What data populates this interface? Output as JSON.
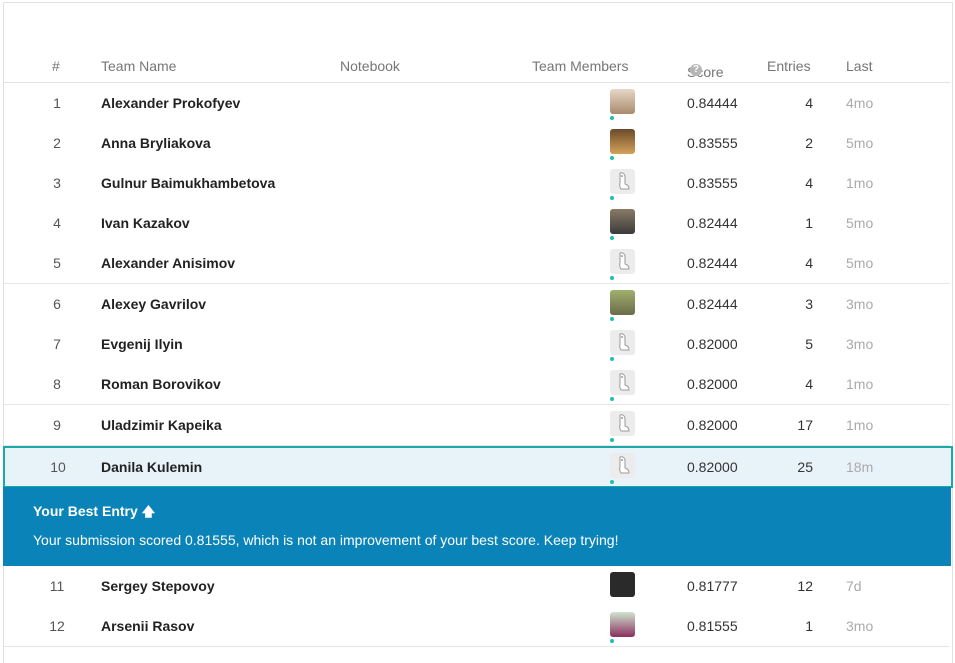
{
  "header": {
    "rank": "#",
    "team_name": "Team Name",
    "notebook": "Notebook",
    "team_members": "Team Members",
    "score": "Score",
    "entries": "Entries",
    "last": "Last"
  },
  "rows": [
    {
      "rank": "1",
      "name": "Alexander Prokofyev",
      "score": "0.84444",
      "entries": "4",
      "last": "4mo",
      "avatar": "photo"
    },
    {
      "rank": "2",
      "name": "Anna Bryliakova",
      "score": "0.83555",
      "entries": "2",
      "last": "5mo",
      "avatar": "photo"
    },
    {
      "rank": "3",
      "name": "Gulnur Baimukhambetova",
      "score": "0.83555",
      "entries": "4",
      "last": "1mo",
      "avatar": "goose"
    },
    {
      "rank": "4",
      "name": "Ivan Kazakov",
      "score": "0.82444",
      "entries": "1",
      "last": "5mo",
      "avatar": "photo"
    },
    {
      "rank": "5",
      "name": "Alexander Anisimov",
      "score": "0.82444",
      "entries": "4",
      "last": "5mo",
      "avatar": "goose"
    },
    {
      "rank": "6",
      "name": "Alexey Gavrilov",
      "score": "0.82444",
      "entries": "3",
      "last": "3mo",
      "avatar": "photo"
    },
    {
      "rank": "7",
      "name": "Evgenij Ilyin",
      "score": "0.82000",
      "entries": "5",
      "last": "3mo",
      "avatar": "goose"
    },
    {
      "rank": "8",
      "name": "Roman Borovikov",
      "score": "0.82000",
      "entries": "4",
      "last": "1mo",
      "avatar": "goose"
    },
    {
      "rank": "9",
      "name": "Uladzimir Kapeika",
      "score": "0.82000",
      "entries": "17",
      "last": "1mo",
      "avatar": "goose"
    },
    {
      "rank": "10",
      "name": "Danila Kulemin",
      "score": "0.82000",
      "entries": "25",
      "last": "18m",
      "avatar": "goose"
    },
    {
      "rank": "11",
      "name": "Sergey Stepovoy",
      "score": "0.81777",
      "entries": "12",
      "last": "7d",
      "avatar": "photo"
    },
    {
      "rank": "12",
      "name": "Arsenii Rasov",
      "score": "0.81555",
      "entries": "1",
      "last": "3mo",
      "avatar": "photo"
    }
  ],
  "banner": {
    "title": "Your Best Entry",
    "message": "Your submission scored 0.81555, which is not an improvement of your best score. Keep trying!"
  },
  "icons": {
    "help": "question-circle-icon",
    "arrow": "arrow-up-icon"
  },
  "colors": {
    "banner_bg": "#0a84b8",
    "highlight_border": "#1ca8a8",
    "highlight_bg": "#e8f3f9",
    "status_dot": "#20beb0"
  }
}
